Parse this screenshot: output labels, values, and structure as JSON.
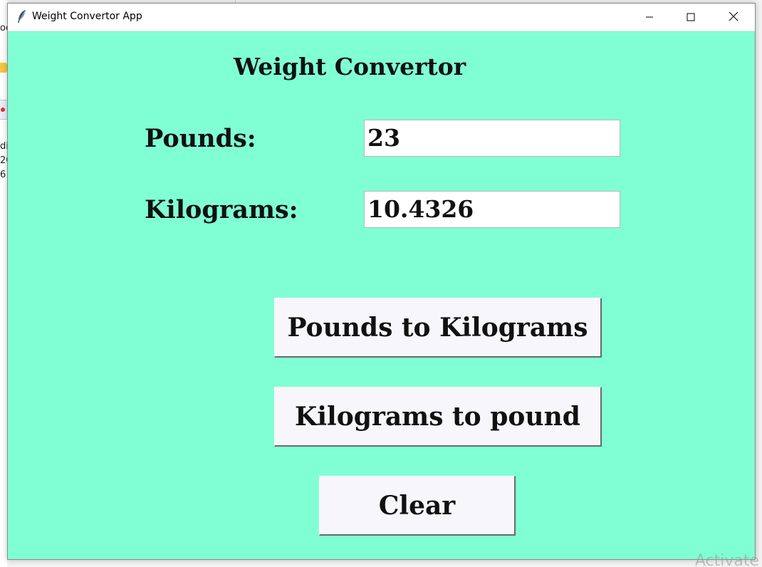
{
  "window": {
    "title": "Weight Convertor App",
    "icon": "feather-icon",
    "background_color": "#80ffd4",
    "controls": {
      "minimize_icon": "minimize-icon",
      "maximize_icon": "maximize-icon",
      "close_icon": "close-icon"
    }
  },
  "background": {
    "fragments": [
      "oc",
      "di",
      "20",
      "6"
    ],
    "watermark": "Activate"
  },
  "main": {
    "heading": "Weight Convertor",
    "pounds_label": "Pounds:",
    "pounds_value": "23",
    "kilograms_label": "Kilograms:",
    "kilograms_value": "10.4326",
    "buttons": {
      "pounds_to_kg": "Pounds to Kilograms",
      "kg_to_pounds": "Kilograms to pound",
      "clear": "Clear"
    }
  }
}
